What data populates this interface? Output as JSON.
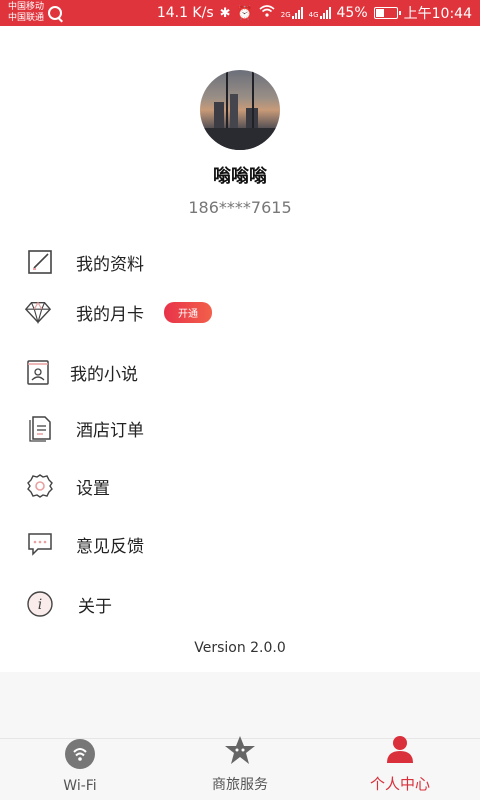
{
  "status_bar": {
    "carrier1": "中国移动",
    "carrier2": "中国联通",
    "speed": "14.1 K/s",
    "battery": "45%",
    "battery_level": 0.45,
    "time": "上午10:44",
    "net1": "2G",
    "net2": "4G"
  },
  "profile": {
    "nickname": "嗡嗡嗡",
    "phone": "186****7615"
  },
  "menu": {
    "profile_label": "我的资料",
    "monthly_card_label": "我的月卡",
    "monthly_card_badge": "开通",
    "novels_label": "我的小说",
    "hotel_orders_label": "酒店订单",
    "settings_label": "设置",
    "feedback_label": "意见反馈",
    "about_label": "关于"
  },
  "version": "Version 2.0.0",
  "bottom_nav": {
    "wifi_label": "Wi-Fi",
    "business_label": "商旅服务",
    "personal_label": "个人中心"
  },
  "colors": {
    "accent": "#d9303b",
    "status_bar": "#e0343d",
    "icon_stroke": "#444444",
    "icon_accent": "#e8a0a0"
  }
}
